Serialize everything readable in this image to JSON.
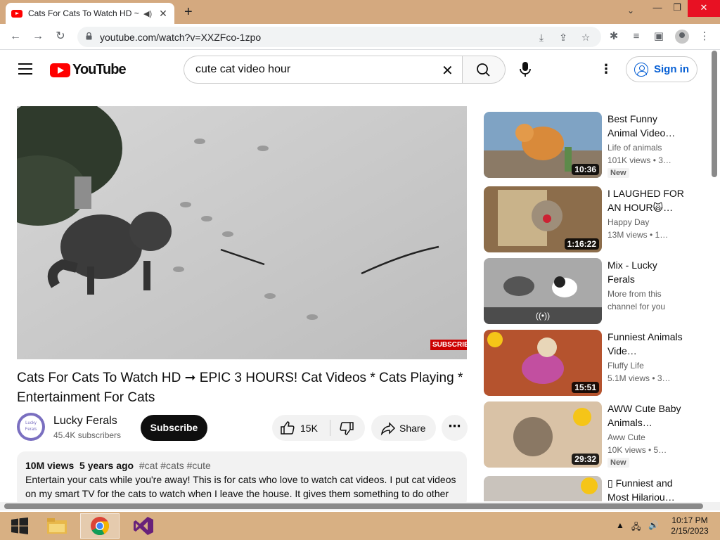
{
  "browser": {
    "tab_title": "Cats For Cats To Watch HD ~",
    "url": "youtube.com/watch?v=XXZFco-1zpo"
  },
  "youtube": {
    "logo_text": "YouTube",
    "search_value": "cute cat video hour",
    "signin_label": "Sign in"
  },
  "video": {
    "watermark": "SUBSCRIBE",
    "title": "Cats For Cats To Watch HD ➞ EPIC 3 HOURS! Cat Videos * Cats Playing * Entertainment For Cats",
    "channel_name": "Lucky Ferals",
    "channel_avatar_text": "Lucky Ferals",
    "subscribers": "45.4K subscribers",
    "subscribe_label": "Subscribe",
    "likes": "15K",
    "share_label": "Share",
    "views": "10M views",
    "age": "5 years ago",
    "tags": "#cat #cats #cute",
    "description": "Entertain your cats while you're away! This is for cats who love to watch cat videos. I put cat videos on my smart TV for the cats to watch when I leave the house. It gives them something to do other"
  },
  "recommendations": [
    {
      "title": "Best Funny Animal Video…",
      "channel": "Life of animals",
      "meta": "101K views  • 3…",
      "duration": "10:36",
      "badge": "New"
    },
    {
      "title": "I LAUGHED FOR AN HOUR🙀…",
      "channel": "Happy Day",
      "meta": "13M views  • 1…",
      "duration": "1:16:22",
      "badge": ""
    },
    {
      "title": "Mix - Lucky Ferals",
      "channel": "More from this",
      "meta": "channel for you",
      "duration": "",
      "badge": "",
      "mix_icon": "((•))"
    },
    {
      "title": "Funniest Animals Vide…",
      "channel": "Fluffy Life",
      "meta": "5.1M views  • 3…",
      "duration": "15:51",
      "badge": ""
    },
    {
      "title": "AWW Cute Baby Animals…",
      "channel": "Aww Cute",
      "meta": "10K views  • 5…",
      "duration": "29:32",
      "badge": "New"
    },
    {
      "title": "▯ Funniest and Most Hilariou…",
      "channel": "",
      "meta": "",
      "duration": "",
      "badge": ""
    }
  ],
  "taskbar": {
    "time": "10:17 PM",
    "date": "2/15/2023"
  },
  "colors": {
    "youtube_red": "#ff0000",
    "link_blue": "#065fd4",
    "chrome_frame": "#d4a97f",
    "taskbar": "#d8b083"
  }
}
